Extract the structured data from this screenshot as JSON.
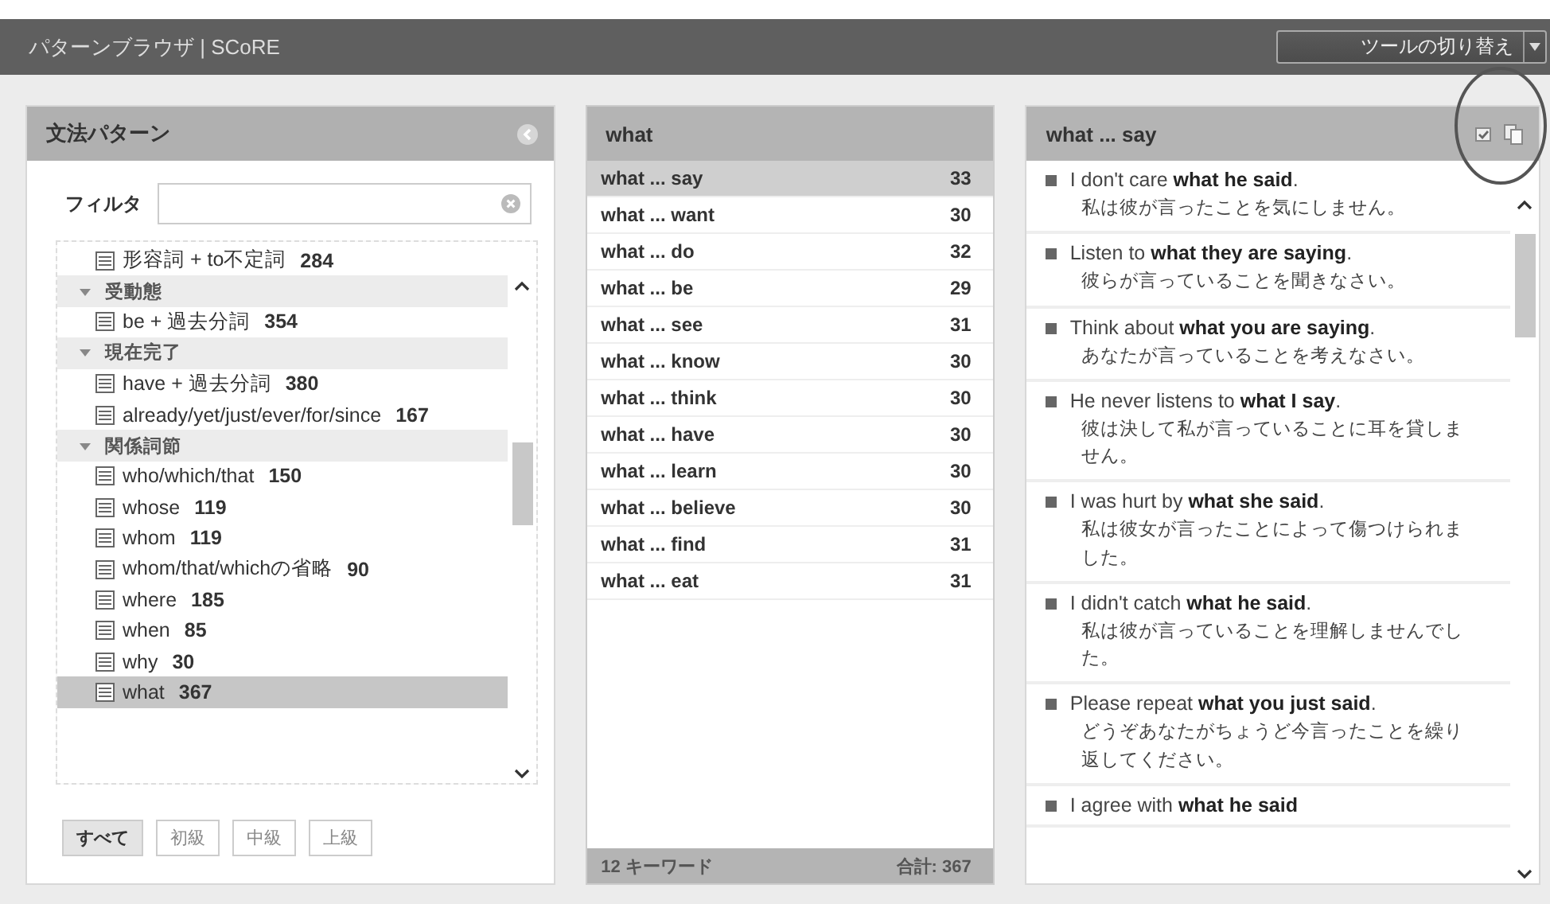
{
  "app_bar": {
    "title": "パターンブラウザ | SCoRE",
    "tool_switch": "ツールの切り替え"
  },
  "grammar_panel": {
    "title": "文法パターン",
    "filter": {
      "label": "フィルタ"
    },
    "tree": [
      {
        "kind": "pattern",
        "label": "形容詞 + to不定詞",
        "count": "284",
        "selected": false
      },
      {
        "kind": "group",
        "label": "受動態",
        "expanded": true,
        "children": [
          {
            "kind": "pattern",
            "label": "be + 過去分詞",
            "count": "354",
            "selected": false
          }
        ]
      },
      {
        "kind": "group",
        "label": "現在完了",
        "expanded": true,
        "children": [
          {
            "kind": "pattern",
            "label": "have + 過去分詞",
            "count": "380",
            "selected": false
          },
          {
            "kind": "pattern",
            "label": "already/yet/just/ever/for/since",
            "count": "167",
            "selected": false
          }
        ]
      },
      {
        "kind": "group",
        "label": "関係詞節",
        "expanded": true,
        "children": [
          {
            "kind": "pattern",
            "label": "who/which/that",
            "count": "150",
            "selected": false
          },
          {
            "kind": "pattern",
            "label": "whose",
            "count": "119",
            "selected": false
          },
          {
            "kind": "pattern",
            "label": "whom",
            "count": "119",
            "selected": false
          },
          {
            "kind": "pattern",
            "label": "whom/that/whichの省略",
            "count": "90",
            "selected": false
          },
          {
            "kind": "pattern",
            "label": "where",
            "count": "185",
            "selected": false
          },
          {
            "kind": "pattern",
            "label": "when",
            "count": "85",
            "selected": false
          },
          {
            "kind": "pattern",
            "label": "why",
            "count": "30",
            "selected": false
          },
          {
            "kind": "pattern",
            "label": "what",
            "count": "367",
            "selected": true
          }
        ]
      }
    ],
    "levels": [
      {
        "label": "すべて",
        "selected": true
      },
      {
        "label": "初級",
        "selected": false
      },
      {
        "label": "中級",
        "selected": false
      },
      {
        "label": "上級",
        "selected": false
      }
    ]
  },
  "keyword_panel": {
    "title": "what",
    "rows": [
      {
        "keyword": "what ... say",
        "count": "33",
        "selected": true
      },
      {
        "keyword": "what ... want",
        "count": "30",
        "selected": false
      },
      {
        "keyword": "what ... do",
        "count": "32",
        "selected": false
      },
      {
        "keyword": "what ... be",
        "count": "29",
        "selected": false
      },
      {
        "keyword": "what ... see",
        "count": "31",
        "selected": false
      },
      {
        "keyword": "what ... know",
        "count": "30",
        "selected": false
      },
      {
        "keyword": "what ... think",
        "count": "30",
        "selected": false
      },
      {
        "keyword": "what ... have",
        "count": "30",
        "selected": false
      },
      {
        "keyword": "what ... learn",
        "count": "30",
        "selected": false
      },
      {
        "keyword": "what ... believe",
        "count": "30",
        "selected": false
      },
      {
        "keyword": "what ... find",
        "count": "31",
        "selected": false
      },
      {
        "keyword": "what ... eat",
        "count": "31",
        "selected": false
      }
    ],
    "footer_count": "12 キーワード",
    "footer_total": "合計: 367"
  },
  "example_panel": {
    "title": "what ... say",
    "examples": [
      {
        "english": "I don't care **what he said**.",
        "japanese": "私は彼が言ったことを気にしません。"
      },
      {
        "english": "Listen to **what they are saying**.",
        "japanese": "彼らが言っていることを聞きなさい。"
      },
      {
        "english": "Think about **what you are saying**.",
        "japanese": "あなたが言っていることを考えなさい。"
      },
      {
        "english": "He never listens to **what I say**.",
        "japanese": "彼は決して私が言っていることに耳を貸しません。"
      },
      {
        "english": "I was hurt by **what she said**.",
        "japanese": "私は彼女が言ったことによって傷つけられました。"
      },
      {
        "english": "I didn't catch **what he said**.",
        "japanese": "私は彼が言っていることを理解しませんでした。"
      },
      {
        "english": "Please repeat **what you just said**.",
        "japanese": "どうぞあなたがちょうど今言ったことを繰り返してください。"
      },
      {
        "english": "I agree with **what he said**"
      }
    ]
  }
}
